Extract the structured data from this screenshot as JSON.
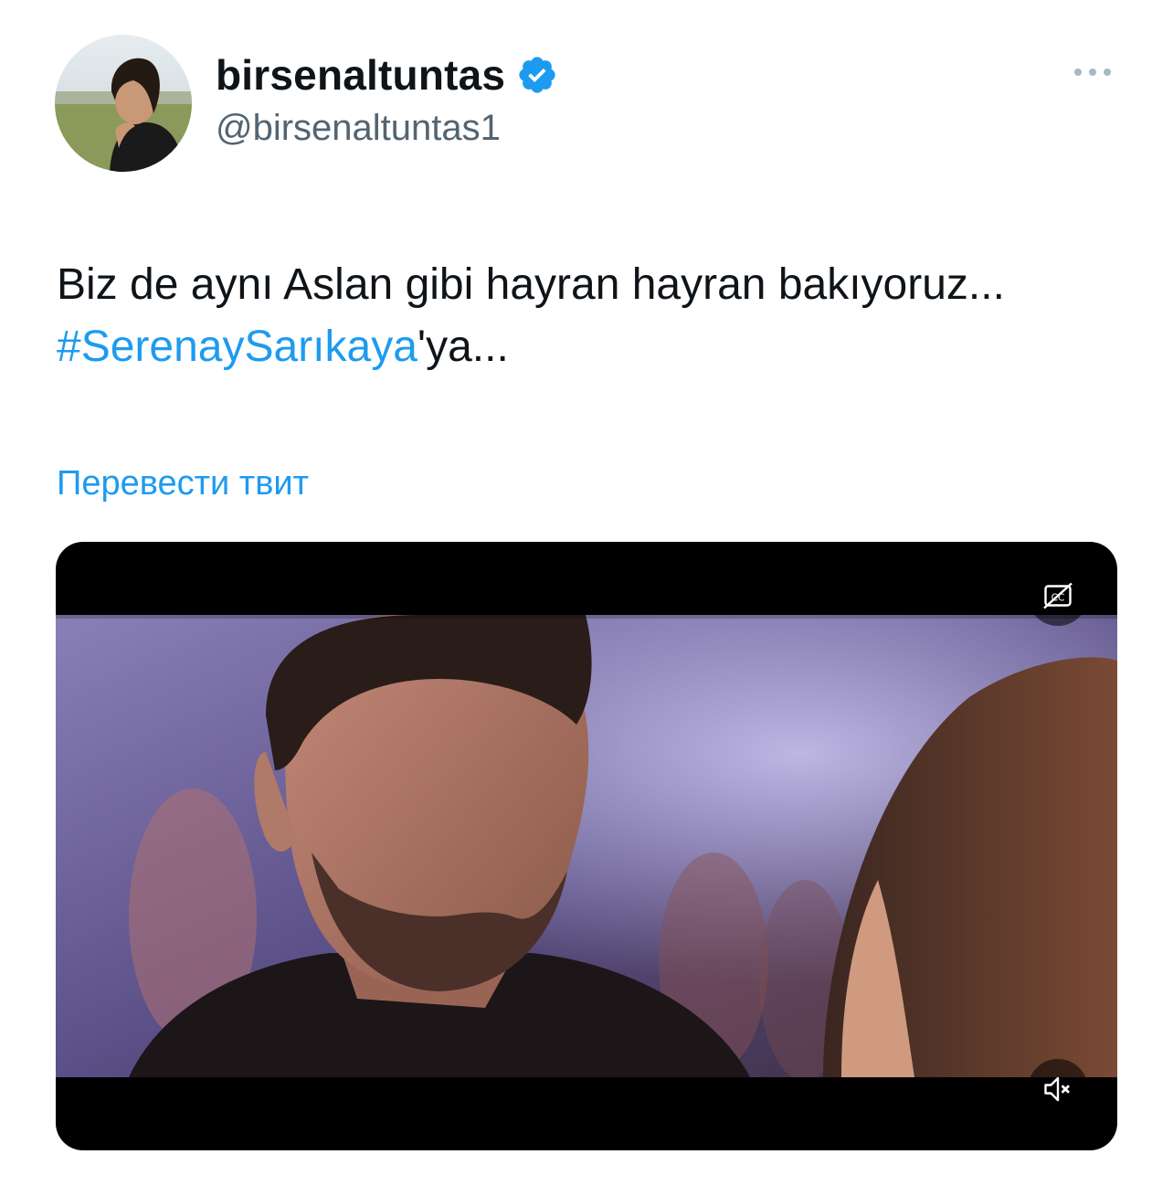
{
  "author": {
    "display_name": "birsenaltuntas",
    "handle": "@birsenaltuntas1",
    "verified": true
  },
  "icons": {
    "verified": "verified-badge-icon",
    "more": "more-options-icon",
    "captions": "closed-captions-icon",
    "mute": "volume-muted-icon"
  },
  "tweet": {
    "text_part1": "Biz de aynı Aslan gibi hayran hayran bakıyoruz... ",
    "hashtag": "#SerenaySarıkaya",
    "text_part2": "'ya..."
  },
  "translate_label": "Перевести твит",
  "colors": {
    "accent": "#1d9bf0",
    "text": "#0f1419",
    "secondary": "#536471"
  }
}
